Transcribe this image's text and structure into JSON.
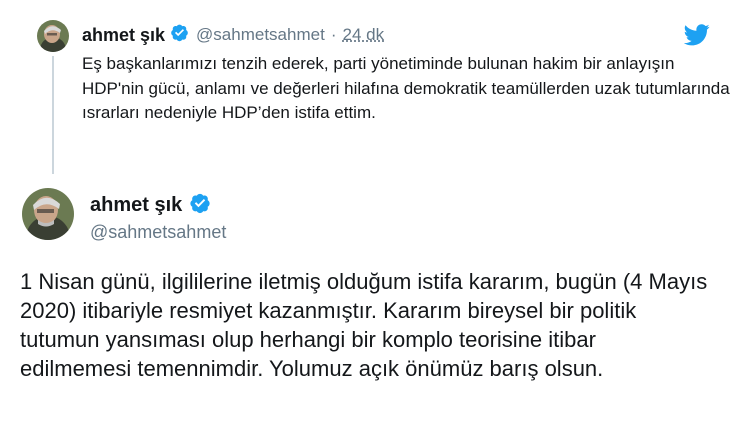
{
  "parent_tweet": {
    "author_name": "ahmet şık",
    "handle": "@sahmetsahmet",
    "separator": "·",
    "time": "24 dk",
    "text": "Eş başkanlarımızı tenzih ederek, parti yönetiminde bulunan hakim bir anlayışın HDP'nin gücü, anlamı ve değerleri hilafına demokratik teamüllerden uzak tutumlarında ısrarları nedeniyle HDP’den istifa ettim.",
    "verified_icon": "verified-badge-icon",
    "logo_icon": "twitter-bird-icon"
  },
  "main_tweet": {
    "author_name": "ahmet şık",
    "handle": "@sahmetsahmet",
    "text": "1 Nisan günü, ilgililerine iletmiş olduğum istifa kararım, bugün (4 Mayıs 2020) itibariyle resmiyet kazanmıştır. Kararım bireysel bir politik tutumun yansıması olup herhangi bir komplo teorisine itibar edilmemesi temennimdir. Yolumuz açık önümüz barış olsun.",
    "verified_icon": "verified-badge-icon"
  },
  "colors": {
    "brand_blue": "#1da1f2",
    "text_primary": "#14171a",
    "text_secondary": "#657786",
    "thread_line": "#ccd6dd"
  }
}
